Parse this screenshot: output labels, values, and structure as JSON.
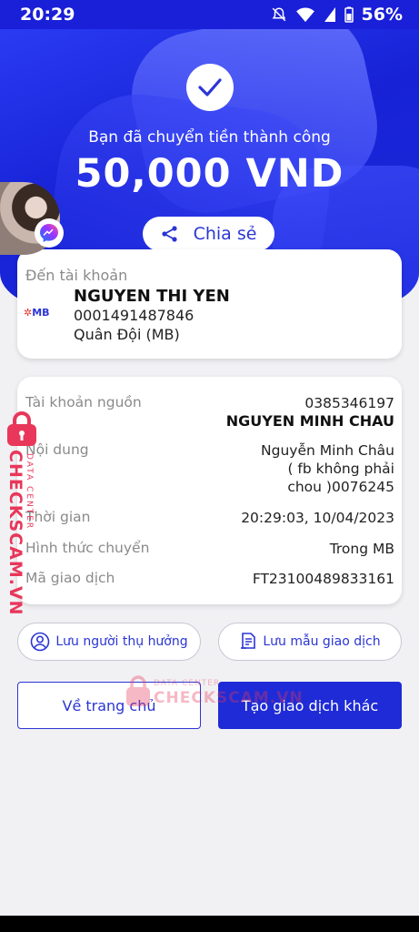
{
  "status_bar": {
    "time": "20:29",
    "battery": "56%"
  },
  "hero": {
    "success_message": "Bạn đã chuyển tiền thành công",
    "amount": "50,000 VND",
    "share_label": "Chia sẻ"
  },
  "destination": {
    "label": "Đến tài khoản",
    "bank_logo_text": "MB",
    "name": "NGUYEN THI YEN",
    "account_number": "0001491487846",
    "bank_name": "Quân Đội (MB)"
  },
  "details": {
    "source_label": "Tài khoản nguồn",
    "source_account": "0385346197",
    "source_name": "NGUYEN MINH CHAU",
    "content_label": "Nội dung",
    "content_line1": "Nguyễn Minh Châu",
    "content_line2": "( fb không phải",
    "content_line3": "chou )0076245",
    "time_label": "Thời gian",
    "time_value": "20:29:03, 10/04/2023",
    "method_label": "Hình thức chuyển",
    "method_value": "Trong MB",
    "txn_label": "Mã giao dịch",
    "txn_value": "FT23100489833161"
  },
  "actions": {
    "save_beneficiary": "Lưu người thụ hưởng",
    "save_template": "Lưu mẫu giao dịch",
    "home": "Về trang chủ",
    "new_transaction": "Tạo giao dịch khác"
  },
  "watermark": {
    "side_main": "CHECKSCAM.VN",
    "side_sub": "DATA CENTER",
    "center_top": "DATA CENTER",
    "center_main": "CHECKSCAM.VN"
  },
  "colors": {
    "primary": "#1f2bd6",
    "watermark": "#e8375a"
  }
}
